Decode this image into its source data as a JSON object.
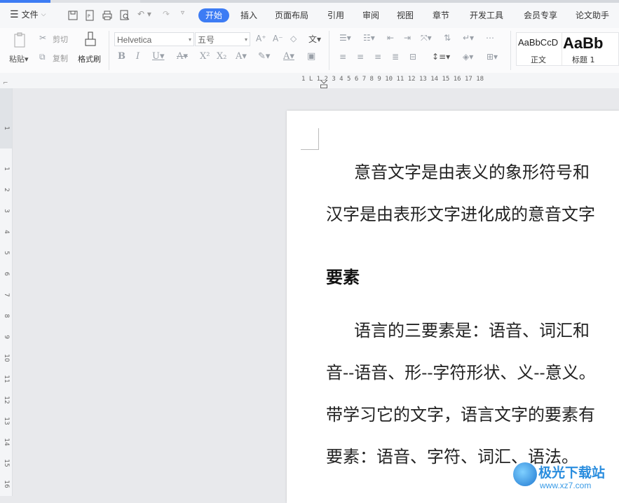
{
  "menubar": {
    "file_label": "文件",
    "tabs": [
      "开始",
      "插入",
      "页面布局",
      "引用",
      "审阅",
      "视图",
      "章节",
      "开发工具",
      "会员专享",
      "论文助手"
    ]
  },
  "ribbon": {
    "paste": "粘贴",
    "cut": "剪切",
    "copy": "复制",
    "format_painter": "格式刷",
    "font_name": "Helvetica",
    "font_size": "五号",
    "style_normal_sample": "AaBbCcD",
    "style_normal_label": "正文",
    "style_h1_sample": "AaBb",
    "style_h1_label": "标题 1"
  },
  "ruler": {
    "h_ticks": "1  L  1  2  3  4  5  6  7  8  9  10  11  12  13  14  15  16  17  18",
    "v_ticks": [
      "1",
      "1",
      "2",
      "3",
      "4",
      "5",
      "6",
      "7",
      "8",
      "9",
      "10",
      "11",
      "12",
      "13",
      "14",
      "15",
      "16"
    ]
  },
  "document": {
    "p1_line1": "意音文字是由表义的象形符号和",
    "p1_line2": "汉字是由表形文字进化成的意音文字",
    "heading": "要素",
    "p2_line1": "语言的三要素是：语音、词汇和",
    "p2_line2": "音--语音、形--字符形状、义--意义。",
    "p2_line3": "带学习它的文字，语言文字的要素有",
    "p2_line4": "要素：语音、字符、词汇、语法。"
  },
  "watermark": {
    "name": "极光下载站",
    "url": "www.xz7.com"
  },
  "colors": {
    "accent": "#3d7cf4",
    "ribbon_bg": "#fbfbfc",
    "canvas_bg": "#e8e9ec"
  }
}
